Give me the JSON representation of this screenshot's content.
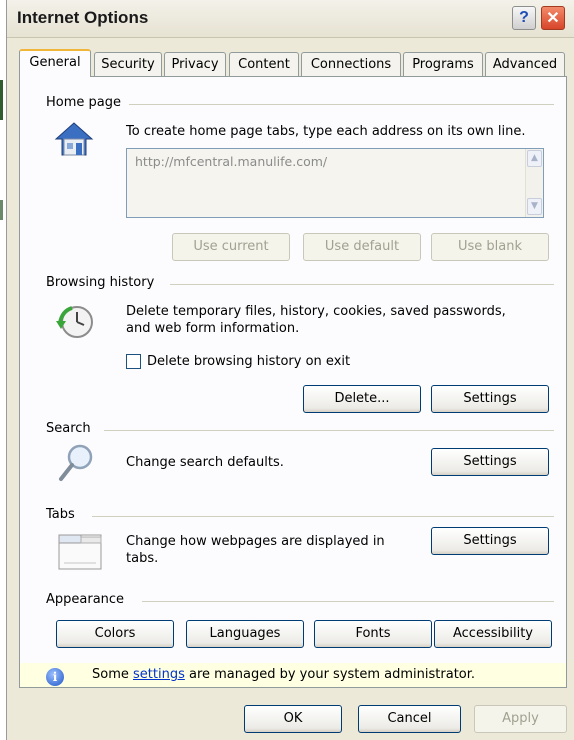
{
  "window": {
    "title": "Internet Options"
  },
  "title_buttons": {
    "help": "?",
    "close": "✕"
  },
  "tabs": [
    {
      "label": "General"
    },
    {
      "label": "Security"
    },
    {
      "label": "Privacy"
    },
    {
      "label": "Content"
    },
    {
      "label": "Connections"
    },
    {
      "label": "Programs"
    },
    {
      "label": "Advanced"
    }
  ],
  "home_page": {
    "title": "Home page",
    "description": "To create home page tabs, type each address on its own line.",
    "address_value": "http://mfcentral.manulife.com/",
    "use_current": "Use current",
    "use_default": "Use default",
    "use_blank": "Use blank"
  },
  "browsing_history": {
    "title": "Browsing history",
    "description_line1": "Delete temporary files, history, cookies, saved passwords,",
    "description_line2": "and web form information.",
    "delete_on_exit_label": "Delete browsing history on exit",
    "delete_on_exit_checked": false,
    "delete_button": "Delete...",
    "settings_button": "Settings"
  },
  "search": {
    "title": "Search",
    "description": "Change search defaults.",
    "settings_button": "Settings"
  },
  "tabs_section": {
    "title": "Tabs",
    "description_line1": "Change how webpages are displayed in",
    "description_line2": "tabs.",
    "settings_button": "Settings"
  },
  "appearance": {
    "title": "Appearance",
    "colors": "Colors",
    "languages": "Languages",
    "fonts": "Fonts",
    "accessibility": "Accessibility"
  },
  "info_bar": {
    "text_before": "Some ",
    "link": "settings",
    "text_after": " are managed by your system administrator."
  },
  "dialog_buttons": {
    "ok": "OK",
    "cancel": "Cancel",
    "apply": "Apply"
  },
  "colors": {
    "accent": "#f0b63a",
    "border": "#003c74",
    "info_bg": "#ffffe1",
    "close": "#d7452a"
  },
  "icons": [
    "house-icon",
    "clock-arrow-icon",
    "magnifier-icon",
    "tabs-window-icon",
    "info-icon"
  ]
}
